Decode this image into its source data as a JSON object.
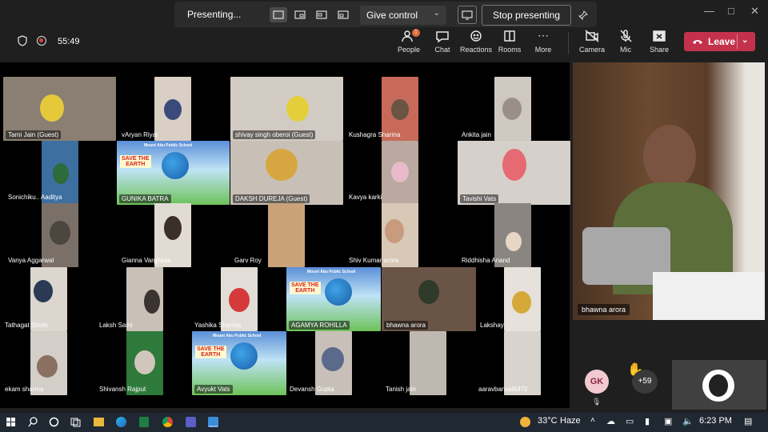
{
  "presenting_bar": {
    "status": "Presenting...",
    "give_control": "Give control",
    "stop_presenting": "Stop presenting"
  },
  "meeting": {
    "timer": "55:49",
    "people_badge": "1"
  },
  "toolbar": {
    "people": "People",
    "chat": "Chat",
    "reactions": "Reactions",
    "rooms": "Rooms",
    "more": "More",
    "camera": "Camera",
    "mic": "Mic",
    "share": "Share",
    "leave": "Leave"
  },
  "participants": [
    "Tarni Jain (Guest)",
    "vAryan Riyal",
    "shivay singh oberoi (Guest)",
    "Kushagra Sharma",
    "Ankita jain",
    "Sonichiku.. Aaditya",
    "GUNIKA BATRA",
    "DAKSH DUREJA (Guest)",
    "Kavya karki",
    "Tavishi Vats",
    "Vanya Aggarwal",
    "Gianna Varghese",
    "Garv Roy",
    "Shiv Kumar arora",
    "Riddhisha Anand",
    "Tathagat Shom",
    "Laksh  Saini",
    "Yashika Sharma",
    "AGAMYA ROHILLA",
    "bhawna arora",
    "Lakshay",
    "ekam sharma",
    "Shivansh Rajput",
    "Avyukt Vats",
    "Devansh Gupta",
    "Tanish jain",
    "aaravbansal6372"
  ],
  "poster": {
    "school": "Mount Abu Public School",
    "title_line1": "SAVE THE",
    "title_line2": "EARTH",
    "subtitle": "Paper Making Activity"
  },
  "spotlight": {
    "name": "bhawna arora"
  },
  "gallery_extra": {
    "avatar_initials": "GK",
    "overflow_count": "+59"
  },
  "taskbar": {
    "weather_temp": "33°C",
    "weather_text": "Haze",
    "time": "6:23 PM"
  },
  "colors": {
    "leave": "#c4314b",
    "background": "#1f1f1f",
    "taskbar": "#202832"
  }
}
